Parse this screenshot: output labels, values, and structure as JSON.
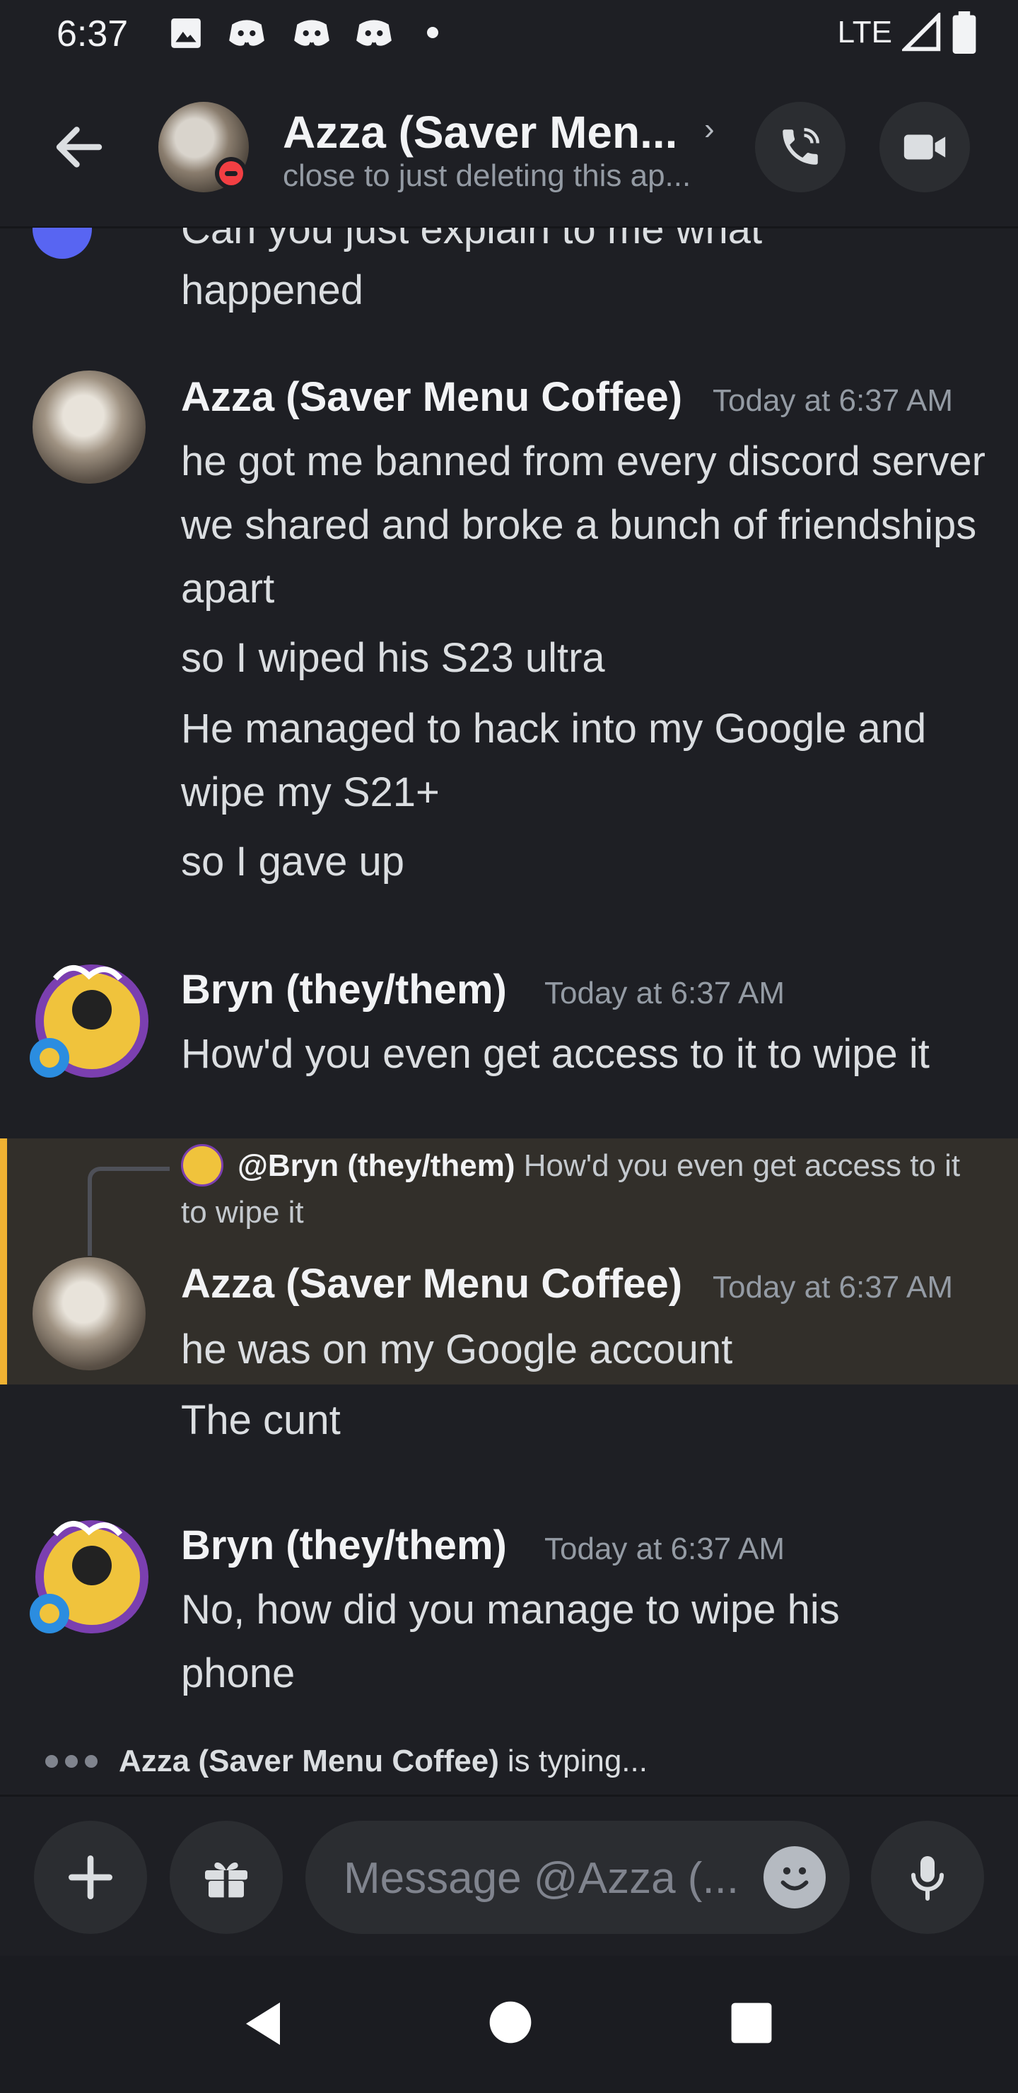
{
  "status_bar": {
    "time": "6:37",
    "network": "LTE"
  },
  "header": {
    "title": "Azza (Saver Men...",
    "status": "close to just deleting this ap..."
  },
  "messages": {
    "partial_top": {
      "line1": "Can you just explain to me what",
      "line2": "happened"
    },
    "group1": {
      "author": "Azza (Saver Menu Coffee)",
      "timestamp": "Today at 6:37 AM",
      "m1": "he got me banned from every discord server we shared and broke a bunch of friendships apart",
      "m2": "so I wiped his S23 ultra",
      "m3": "He managed to hack into my Google and wipe my S21+",
      "m4": "so I gave up"
    },
    "group2": {
      "author": "Bryn (they/them)",
      "timestamp": "Today at 6:37 AM",
      "m1": "How'd you even get access to it to wipe it"
    },
    "group3": {
      "reply_name": "@Bryn (they/them)",
      "reply_text": "How'd you even get access to it to wipe it",
      "author": "Azza (Saver Menu Coffee)",
      "timestamp": "Today at 6:37 AM",
      "m1": "he was on my Google account",
      "m2": "The cunt"
    },
    "group4": {
      "author": "Bryn (they/them)",
      "timestamp": "Today at 6:37 AM",
      "m1": "No, how did you manage to wipe his phone"
    }
  },
  "typing": {
    "name": "Azza (Saver Menu Coffee)",
    "suffix": "is typing..."
  },
  "composer": {
    "placeholder": "Message @Azza (..."
  },
  "colors": {
    "background": "#1e1f24",
    "reply_highlight": "#322f2a",
    "reply_accent": "#f0b232",
    "dnd": "#f23f43"
  },
  "icons": [
    "image-icon",
    "discord-icon",
    "signal-icon",
    "battery-icon",
    "back-arrow-icon",
    "phone-icon",
    "video-icon",
    "plus-icon",
    "gift-icon",
    "emoji-icon",
    "mic-icon",
    "nav-back-icon",
    "nav-home-icon",
    "nav-recents-icon"
  ]
}
